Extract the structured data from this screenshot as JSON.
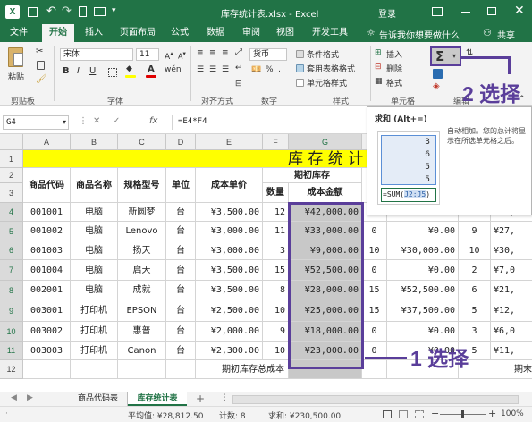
{
  "titlebar": {
    "doc_title": "库存统计表.xlsx  -  Excel",
    "login": "登录"
  },
  "menu": {
    "tabs": [
      "文件",
      "开始",
      "插入",
      "页面布局",
      "公式",
      "数据",
      "审阅",
      "视图",
      "开发工具"
    ],
    "active": "开始",
    "tell": "告诉我你想要做什么",
    "share": "共享"
  },
  "ribbon": {
    "paste": "粘贴",
    "clipboard": "剪贴板",
    "font_name": "宋体",
    "font_size": "11",
    "font_group": "字体",
    "align_group": "对齐方式",
    "number_format": "货币",
    "number_group": "数字",
    "cond_format": "条件格式",
    "table_format": "套用表格格式",
    "cell_style": "单元格样式",
    "style_group": "样式",
    "insert": "插入",
    "delete": "删除",
    "format": "格式",
    "cells_group": "单元格",
    "editing_group": "编辑",
    "sum_symbol": "Σ"
  },
  "formula_bar": {
    "name_box": "G4",
    "fx": "fx",
    "formula": "=E4*F4"
  },
  "tooltip": {
    "title": "求和 (Alt+=)",
    "desc": "自动相加。您的总计将显示在所选单元格之后。",
    "preview_values": [
      "3",
      "6",
      "5",
      "5"
    ],
    "preview_formula": "=SUM(",
    "preview_range": "J2:J5",
    ")": ")"
  },
  "annotation": {
    "step1": "1 选择",
    "step2": "2 选择"
  },
  "sheet": {
    "columns": [
      "A",
      "B",
      "C",
      "D",
      "E",
      "F",
      "G",
      "H"
    ],
    "rows": [
      "1",
      "2",
      "3",
      "4",
      "5",
      "6",
      "7",
      "8",
      "9",
      "10",
      "11",
      "12"
    ],
    "title": "库 存 统 计",
    "headers": {
      "a": "商品代码",
      "b": "商品名称",
      "c": "规格型号",
      "d": "单位",
      "e": "成本单价",
      "fg": "期初库存",
      "f": "数量",
      "g": "成本金额",
      "h": "数",
      "j": "期"
    },
    "data": [
      {
        "a": "001001",
        "b": "电脑",
        "c": "新圆梦",
        "d": "台",
        "e": "¥3,500.00",
        "f": "12",
        "g": "¥42,000.00",
        "h": "0",
        "i": "¥0.00",
        "j": "9",
        "k": "¥27,"
      },
      {
        "a": "001002",
        "b": "电脑",
        "c": "Lenovo",
        "d": "台",
        "e": "¥3,000.00",
        "f": "11",
        "g": "¥33,000.00",
        "h": "0",
        "i": "¥0.00",
        "j": "9",
        "k": "¥27,"
      },
      {
        "a": "001003",
        "b": "电脑",
        "c": "扬天",
        "d": "台",
        "e": "¥3,000.00",
        "f": "3",
        "g": "¥9,000.00",
        "h": "10",
        "i": "¥30,000.00",
        "j": "10",
        "k": "¥30,"
      },
      {
        "a": "001004",
        "b": "电脑",
        "c": "启天",
        "d": "台",
        "e": "¥3,500.00",
        "f": "15",
        "g": "¥52,500.00",
        "h": "0",
        "i": "¥0.00",
        "j": "2",
        "k": "¥7,0"
      },
      {
        "a": "002001",
        "b": "电脑",
        "c": "成就",
        "d": "台",
        "e": "¥3,500.00",
        "f": "8",
        "g": "¥28,000.00",
        "h": "15",
        "i": "¥52,500.00",
        "j": "6",
        "k": "¥21,"
      },
      {
        "a": "003001",
        "b": "打印机",
        "c": "EPSON",
        "d": "台",
        "e": "¥2,500.00",
        "f": "10",
        "g": "¥25,000.00",
        "h": "15",
        "i": "¥37,500.00",
        "j": "5",
        "k": "¥12,"
      },
      {
        "a": "003002",
        "b": "打印机",
        "c": "惠普",
        "d": "台",
        "e": "¥2,000.00",
        "f": "9",
        "g": "¥18,000.00",
        "h": "0",
        "i": "¥0.00",
        "j": "3",
        "k": "¥6,0"
      },
      {
        "a": "003003",
        "b": "打印机",
        "c": "Canon",
        "d": "台",
        "e": "¥2,300.00",
        "f": "10",
        "g": "¥23,000.00",
        "h": "0",
        "i": "¥0.00",
        "j": "5",
        "k": "¥11,"
      }
    ],
    "total_label": "期初库存总成本",
    "total_right": "期末"
  },
  "sheet_tabs": {
    "tab1": "商品代码表",
    "tab2": "库存统计表",
    "add": "+"
  },
  "status": {
    "average": "平均值: ¥28,812.50",
    "count": "计数: 8",
    "sum": "求和: ¥230,500.00",
    "zoom": "100%"
  },
  "colors": {
    "excel_green": "#217346",
    "title_yellow": "#ffff00",
    "annotation": "#5a3e9a",
    "selection_gray": "#c8c8c8"
  }
}
